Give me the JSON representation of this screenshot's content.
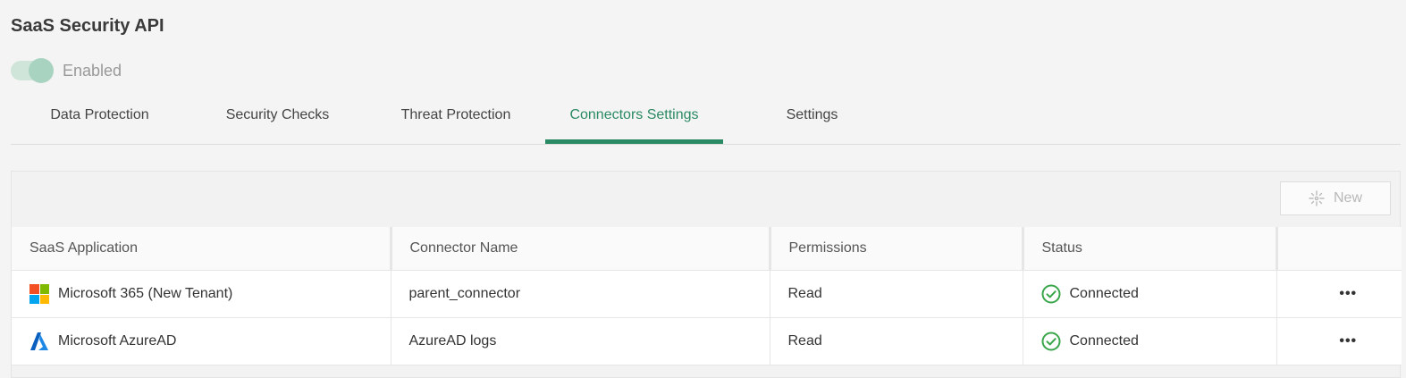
{
  "page": {
    "title": "SaaS Security API"
  },
  "toggle": {
    "label": "Enabled",
    "state": "on"
  },
  "tabs": [
    {
      "label": "Data Protection"
    },
    {
      "label": "Security Checks"
    },
    {
      "label": "Threat Protection"
    },
    {
      "label": "Connectors Settings",
      "active": true
    },
    {
      "label": "Settings"
    }
  ],
  "toolbar": {
    "new_label": "New"
  },
  "table": {
    "headers": [
      "SaaS Application",
      "Connector Name",
      "Permissions",
      "Status",
      ""
    ],
    "rows": [
      {
        "app": "Microsoft 365 (New Tenant)",
        "icon": "microsoft-365-icon",
        "connector": "parent_connector",
        "permissions": "Read",
        "status": "Connected"
      },
      {
        "app": "Microsoft AzureAD",
        "icon": "azure-ad-icon",
        "connector": "AzureAD logs",
        "permissions": "Read",
        "status": "Connected"
      }
    ]
  },
  "colors": {
    "accent": "#2a8a63",
    "status_ok": "#3aa64b",
    "action_dots": "#3a6ea5",
    "ms_red": "#f25022",
    "ms_green": "#7fba00",
    "ms_blue": "#00a4ef",
    "ms_yellow": "#ffb900",
    "azure_blue": "#0a5fbf"
  }
}
